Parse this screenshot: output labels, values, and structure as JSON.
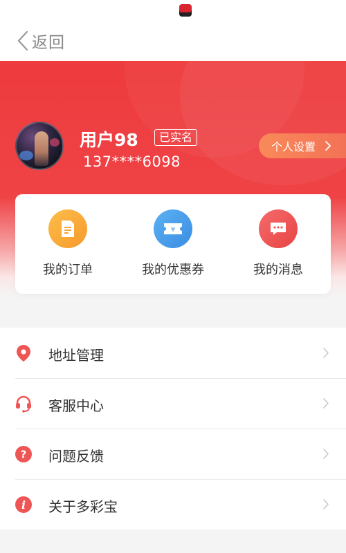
{
  "status_bar": {
    "app_icon": "app-icon"
  },
  "nav": {
    "back_label": "返回",
    "back_icon": "chevron-left-icon"
  },
  "profile": {
    "username": "用户98",
    "verified_badge": "已实名",
    "phone": "137****6098",
    "avatar_icon": "user-avatar",
    "settings_label": "个人设置",
    "settings_icon": "chevron-right-icon"
  },
  "quick_actions": [
    {
      "label": "我的订单",
      "icon": "order-document-icon",
      "color": "#f8a43a"
    },
    {
      "label": "我的优惠券",
      "icon": "coupon-icon",
      "color": "#4a9eea"
    },
    {
      "label": "我的消息",
      "icon": "message-icon",
      "color": "#ee5656"
    }
  ],
  "menu": [
    {
      "label": "地址管理",
      "icon": "location-pin-icon"
    },
    {
      "label": "客服中心",
      "icon": "headset-icon"
    },
    {
      "label": "问题反馈",
      "icon": "question-icon"
    },
    {
      "label": "关于多彩宝",
      "icon": "info-icon"
    }
  ],
  "colors": {
    "brand_red": "#ee3b3d",
    "menu_icon_red": "#ee5656",
    "settings_orange": "#f7805a"
  }
}
